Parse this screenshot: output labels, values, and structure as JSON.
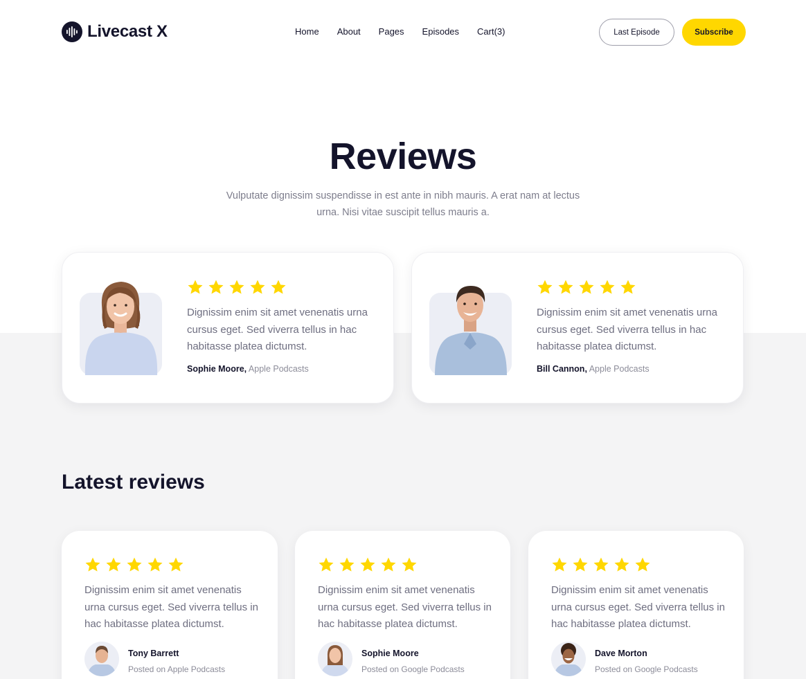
{
  "brand": {
    "name": "Livecast X",
    "icon": "soundwave-icon"
  },
  "nav": {
    "items": [
      {
        "label": "Home"
      },
      {
        "label": "About"
      },
      {
        "label": "Pages"
      },
      {
        "label": "Episodes"
      },
      {
        "label": "Cart(3)"
      }
    ]
  },
  "header": {
    "last_episode_label": "Last Episode",
    "subscribe_label": "Subscribe"
  },
  "hero": {
    "title": "Reviews",
    "subtitle": "Vulputate dignissim suspendisse in est ante in nibh mauris. A erat nam at lectus urna. Nisi vitae suscipit tellus mauris a."
  },
  "featured_reviews": [
    {
      "rating": 5,
      "quote": "Dignissim enim sit amet venenatis urna cursus eget. Sed viverra tellus in hac habitasse platea dictumst.",
      "name": "Sophie Moore,",
      "source": "Apple Podcasts"
    },
    {
      "rating": 5,
      "quote": "Dignissim enim sit amet venenatis urna cursus eget. Sed viverra tellus in hac habitasse platea dictumst.",
      "name": "Bill Cannon,",
      "source": "Apple Podcasts"
    }
  ],
  "latest": {
    "title": "Latest reviews",
    "reviews": [
      {
        "rating": 5,
        "quote": "Dignissim enim sit amet venenatis urna cursus eget. Sed viverra tellus in hac habitasse platea dictumst.",
        "name": "Tony Barrett",
        "source": "Posted on Apple Podcasts"
      },
      {
        "rating": 5,
        "quote": "Dignissim enim sit amet venenatis urna cursus eget. Sed viverra tellus in hac habitasse platea dictumst.",
        "name": "Sophie Moore",
        "source": "Posted on Google Podcasts"
      },
      {
        "rating": 5,
        "quote": "Dignissim enim sit amet venenatis urna cursus eget. Sed viverra tellus in hac habitasse platea dictumst.",
        "name": "Dave Morton",
        "source": "Posted on Google Podcasts"
      }
    ]
  },
  "colors": {
    "accent": "#ffd700",
    "ink": "#14142b",
    "muted": "#6e6e80"
  }
}
